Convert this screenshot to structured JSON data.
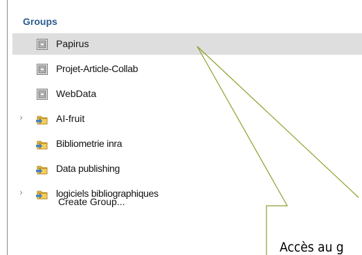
{
  "panel": {
    "header": "Groups",
    "items": [
      {
        "label": "Papirus",
        "icon": "shared-library-icon",
        "selected": true,
        "expandable": false
      },
      {
        "label": "Projet-Article-Collab",
        "icon": "shared-library-icon",
        "selected": false,
        "expandable": false
      },
      {
        "label": "WebData",
        "icon": "shared-library-icon",
        "selected": false,
        "expandable": false
      },
      {
        "label": "AI-fruit",
        "icon": "group-folder-icon",
        "selected": false,
        "expandable": true
      },
      {
        "label": "Bibliometrie inra",
        "icon": "group-folder-icon",
        "selected": false,
        "expandable": false
      },
      {
        "label": "Data publishing",
        "icon": "group-folder-icon",
        "selected": false,
        "expandable": false
      },
      {
        "label": "logiciels bibliographiques",
        "icon": "group-folder-icon",
        "selected": false,
        "expandable": true
      }
    ],
    "create_group": "Create Group..."
  },
  "callout": {
    "text": "Accès au g"
  },
  "colors": {
    "header": "#2c5b8f",
    "selected_bg": "#dedede",
    "callout_line": "#8aa12a"
  }
}
